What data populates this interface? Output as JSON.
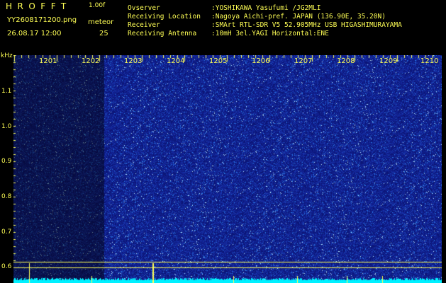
{
  "header": {
    "app_title": "HROFFT",
    "app_version": "1.00f",
    "filename": "YY2608171200.png",
    "datetime": "26.08.17 12:00",
    "meteor_label": "meteor",
    "meteor_count": "25"
  },
  "info": [
    {
      "key": "Ovserver",
      "value": ":YOSHIKAWA Yasufumi /JG2MLI"
    },
    {
      "key": "Receiving Location",
      "value": ":Nagoya Aichi-pref. JAPAN (136.90E, 35.20N)"
    },
    {
      "key": "Receiver",
      "value": ":SMArt RTL-SDR V5 52.905MHz USB HIGASHIMURAYAMA"
    },
    {
      "key": "Receiving Antenna",
      "value": ":10mH 3el.YAGI Horizontal:ENE"
    }
  ],
  "axis": {
    "y_unit": "kHz",
    "y_ticks": [
      "1.1",
      "1.0",
      "0.9",
      "0.8",
      "0.7",
      "0.6"
    ],
    "x_ticks": [
      "1201",
      "1202",
      "1203",
      "1204",
      "1205",
      "1206",
      "1207",
      "1208",
      "1209",
      "1210"
    ]
  },
  "colors": {
    "text": "#ffff55",
    "waterfall_background": "#1b2f9a",
    "noise_floor": "#00f0ff",
    "marker_line": "#ffff55"
  }
}
